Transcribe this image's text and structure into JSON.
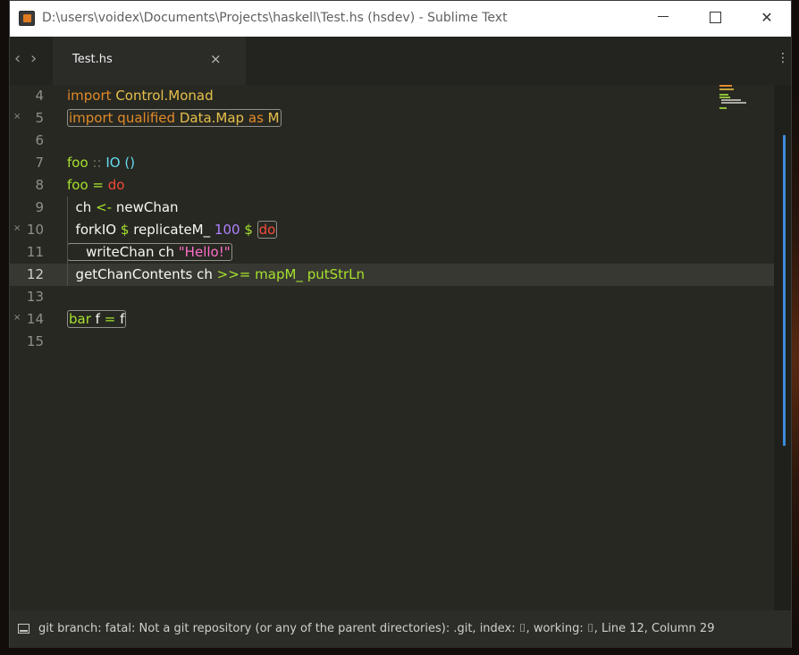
{
  "window": {
    "title": "D:\\users\\voidex\\Documents\\Projects\\haskell\\Test.hs (hsdev) - Sublime Text",
    "minimize_glyph": "",
    "close_glyph": "✕"
  },
  "tabbar": {
    "back_glyph": "‹",
    "forward_glyph": "›",
    "tab_label": "Test.hs",
    "tab_close_glyph": "×",
    "menu_glyph": "⋮"
  },
  "editor": {
    "gutter_mark": "×",
    "lines": [
      {
        "num": "4"
      },
      {
        "num": "5"
      },
      {
        "num": "6"
      },
      {
        "num": "7"
      },
      {
        "num": "8"
      },
      {
        "num": "9"
      },
      {
        "num": "10"
      },
      {
        "num": "11"
      },
      {
        "num": "12"
      },
      {
        "num": "13"
      },
      {
        "num": "14"
      },
      {
        "num": "15"
      }
    ],
    "tokens": {
      "l4": [
        "import",
        "Control.Monad"
      ],
      "l5": [
        "import qualified",
        "Data.Map",
        "as",
        "M"
      ],
      "l7": [
        "foo",
        "::",
        "IO",
        "()"
      ],
      "l8": [
        "foo",
        "=",
        "do"
      ],
      "l9": [
        "ch",
        "<-",
        "newChan"
      ],
      "l10": [
        "forkIO",
        "$",
        "replicateM_",
        "100",
        "$",
        "do"
      ],
      "l11": [
        "writeChan ch",
        "\"Hello!\""
      ],
      "l12": [
        "getChanContents ch",
        ">>=",
        "mapM_",
        "putStrLn"
      ],
      "l14": [
        "bar",
        "f",
        "=",
        "f"
      ]
    }
  },
  "statusbar": {
    "text": "git branch: fatal: Not a git repository (or any of the parent directories): .git, index: ⌷, working: ⌷, Line 12, Column 29"
  }
}
